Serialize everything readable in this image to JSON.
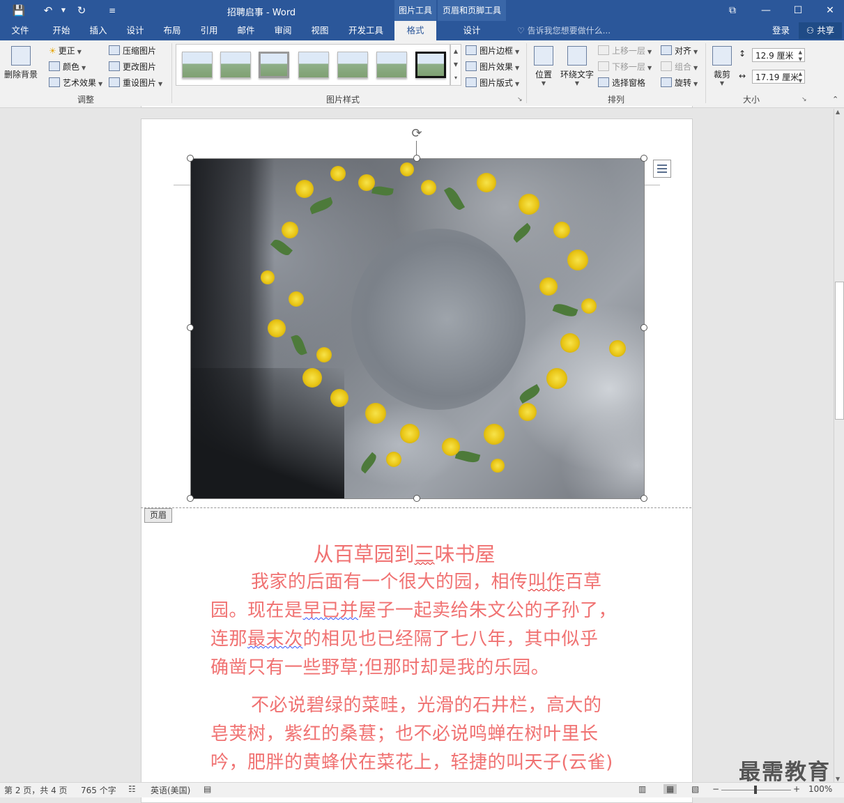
{
  "title_bar": {
    "doc_title": "招聘启事 - Word",
    "context_group_picture": "图片工具",
    "context_group_header": "页眉和页脚工具",
    "quick_access": {
      "save": "💾",
      "undo": "↶",
      "redo": "↻",
      "customize": "≡"
    },
    "window_buttons": {
      "ribbon_display": "⧉",
      "minimize": "—",
      "maximize": "☐",
      "close": "✕"
    }
  },
  "tabs": [
    {
      "label": "文件"
    },
    {
      "label": "开始"
    },
    {
      "label": "插入"
    },
    {
      "label": "设计"
    },
    {
      "label": "布局"
    },
    {
      "label": "引用"
    },
    {
      "label": "邮件"
    },
    {
      "label": "审阅"
    },
    {
      "label": "视图"
    },
    {
      "label": "开发工具"
    },
    {
      "label": "格式",
      "active": true
    },
    {
      "label": "设计"
    }
  ],
  "tell_me": "告诉我您想要做什么...",
  "login": "登录",
  "share": "共享",
  "ribbon": {
    "adjust": {
      "label": "调整",
      "remove_bg": "删除背景",
      "corrections": "更正",
      "color": "颜色",
      "art_effects": "艺术效果",
      "compress": "压缩图片",
      "change": "更改图片",
      "reset": "重设图片"
    },
    "styles": {
      "label": "图片样式",
      "border": "图片边框",
      "effects": "图片效果",
      "layout": "图片版式"
    },
    "arrange": {
      "label": "排列",
      "position": "位置",
      "wrap": "环绕文字",
      "forward": "上移一层",
      "backward": "下移一层",
      "selection": "选择窗格",
      "align": "对齐",
      "group": "组合",
      "rotate": "旋转"
    },
    "size": {
      "label": "大小",
      "crop": "裁剪",
      "height": "12.9 厘米",
      "width": "17.19 厘米"
    }
  },
  "document": {
    "header_tag": "页眉",
    "heading": {
      "pre": "从百草园到",
      "wavy": "三",
      "post": "味书屋"
    },
    "para1": {
      "l1a": "我家的后面有一个很大的园，相传",
      "l1w": "叫作",
      "l1b": "百草",
      "l2a": "园。现在是",
      "l2w": "早已并",
      "l2b": "屋子一起卖给朱文公的子孙了，",
      "l3a": "连那",
      "l3w": "最末次",
      "l3b": "的相见也已经隔了七八年，其中似乎",
      "l4": "确凿只有一些野草;但那时却是我的乐园。"
    },
    "para2": {
      "l1": "不必说碧绿的菜畦，光滑的石井栏，高大的",
      "l2": "皂荚树，紫红的桑葚；也不必说鸣蝉在树叶里长",
      "l3": "吟，肥胖的黄蜂伏在菜花上，轻捷的叫天子(云雀)"
    }
  },
  "status": {
    "page": "第 2 页，共 4 页",
    "words": "765 个字",
    "lang": "英语(美国)",
    "zoom": "100%"
  },
  "watermark": "最需教育"
}
